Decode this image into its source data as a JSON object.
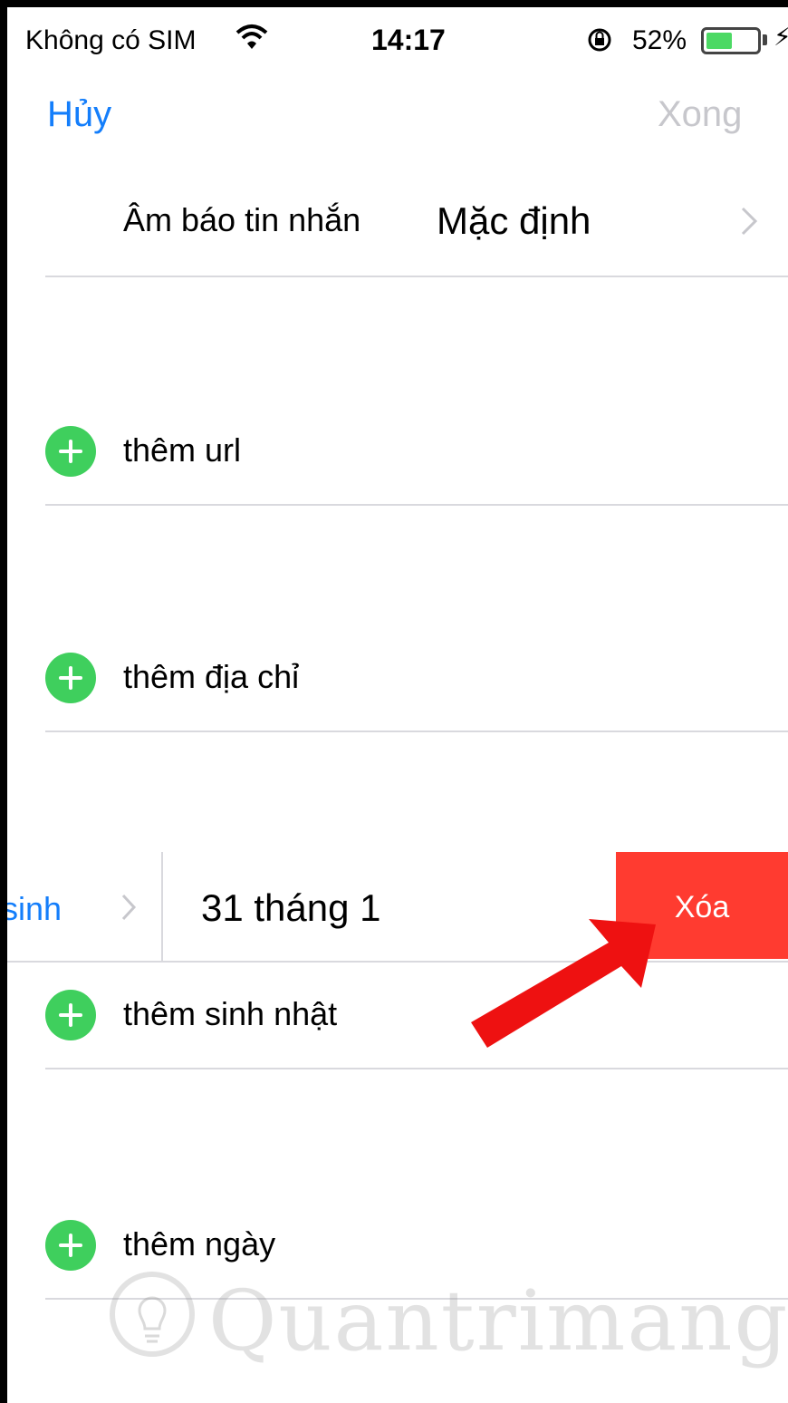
{
  "status_bar": {
    "carrier": "Không có SIM",
    "time": "14:17",
    "battery_percent": "52%",
    "battery_level": 0.52
  },
  "nav": {
    "cancel_label": "Hủy",
    "done_label": "Xong"
  },
  "ringtone": {
    "label": "Âm báo tin nhắn",
    "value": "Mặc định"
  },
  "add_rows": {
    "url": "thêm url",
    "address": "thêm địa chỉ",
    "birthday": "thêm sinh nhật",
    "date": "thêm ngày"
  },
  "birthday_row": {
    "label": "y sinh",
    "value": "31 tháng 1",
    "delete_label": "Xóa"
  },
  "watermark": {
    "text": "Quantrimang"
  },
  "colors": {
    "accent": "#147efb",
    "add_green": "#3fcf5d",
    "delete_red": "#ff3b30",
    "arrow_red": "#ee1111"
  },
  "icons": {
    "wifi": "wifi-icon",
    "orientation_lock": "orientation-lock-icon",
    "battery": "battery-icon",
    "charging": "charging-icon",
    "chevron": "chevron-right-icon",
    "add": "plus-circle-icon",
    "arrow": "red-arrow-icon"
  }
}
